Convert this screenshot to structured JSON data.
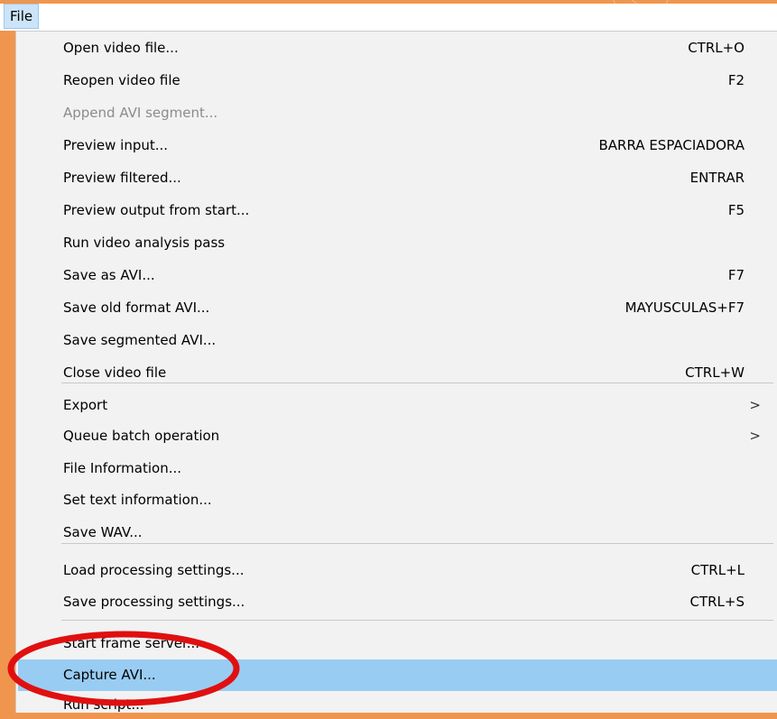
{
  "menubar": {
    "file_label": "File"
  },
  "menu": {
    "items": [
      {
        "label": "Open video file...",
        "shortcut": "CTRL+O"
      },
      {
        "label": "Reopen video file",
        "shortcut": "F2"
      },
      {
        "label": "Append AVI segment...",
        "shortcut": "",
        "disabled": true
      },
      {
        "label": "Preview input...",
        "shortcut": "BARRA ESPACIADORA"
      },
      {
        "label": "Preview filtered...",
        "shortcut": "ENTRAR"
      },
      {
        "label": "Preview output from start...",
        "shortcut": "F5"
      },
      {
        "label": "Run video analysis pass",
        "shortcut": ""
      },
      {
        "label": "Save as AVI...",
        "shortcut": "F7"
      },
      {
        "label": "Save old format AVI...",
        "shortcut": "MAYUSCULAS+F7"
      },
      {
        "label": "Save segmented AVI...",
        "shortcut": ""
      },
      {
        "label": "Close video file",
        "shortcut": "CTRL+W"
      },
      {
        "label": "Export",
        "submenu_arrow": ">"
      },
      {
        "label": "Queue batch operation",
        "submenu_arrow": ">"
      },
      {
        "label": "File Information...",
        "shortcut": ""
      },
      {
        "label": "Set text information...",
        "shortcut": ""
      },
      {
        "label": "Save WAV...",
        "shortcut": ""
      },
      {
        "label": "Load processing settings...",
        "shortcut": "CTRL+L"
      },
      {
        "label": "Save processing settings...",
        "shortcut": "CTRL+S"
      },
      {
        "label": "Start frame server...",
        "shortcut": ""
      },
      {
        "label": "Capture AVI...",
        "shortcut": "",
        "highlighted": true
      },
      {
        "label": "Run script...",
        "shortcut": ""
      }
    ]
  },
  "colors": {
    "background": "#f0954d",
    "menu_background": "#f2f2f2",
    "highlight": "#99ccf3",
    "annotation_circle": "#e01010"
  }
}
